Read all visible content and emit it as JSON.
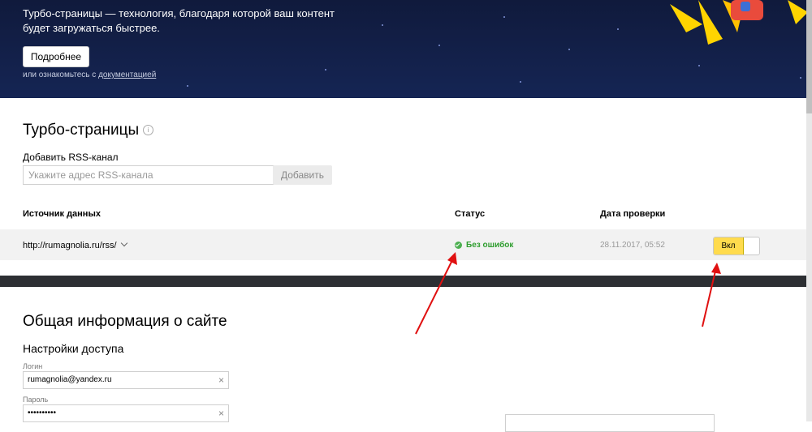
{
  "hero": {
    "text": "Турбо-страницы — технология, благодаря которой ваш контент будет загружаться быстрее.",
    "more_button": "Подробнее",
    "doc_prefix": "или ознакомьтесь с ",
    "doc_link": "документацией"
  },
  "turbo": {
    "title": "Турбо-страницы",
    "info_icon": "i",
    "rss_label": "Добавить RSS-канал",
    "rss_placeholder": "Укажите адрес RSS-канала",
    "add_button": "Добавить"
  },
  "table": {
    "headers": [
      "Источник данных",
      "Статус",
      "Дата проверки"
    ],
    "rows": [
      {
        "source": "http://rumagnolia.ru/rss/",
        "status": "Без ошибок",
        "date": "28.11.2017, 05:52",
        "toggle": "Вкл"
      }
    ]
  },
  "general": {
    "title": "Общая информация о сайте",
    "access_title": "Настройки доступа",
    "login_label": "Логин",
    "login_value": "rumagnolia@yandex.ru",
    "password_label": "Пароль",
    "password_value": "••••••••••",
    "clear_icon": "×"
  },
  "colors": {
    "hero_bg": "#152554",
    "status_ok": "#2e9d2e",
    "toggle_on": "#ffdb4d",
    "annotation_arrow": "#e01010"
  },
  "icons": [
    "rocket-icon",
    "info-icon",
    "chevron-down-icon",
    "check-circle-icon",
    "clear-icon",
    "arrow-annotation"
  ]
}
